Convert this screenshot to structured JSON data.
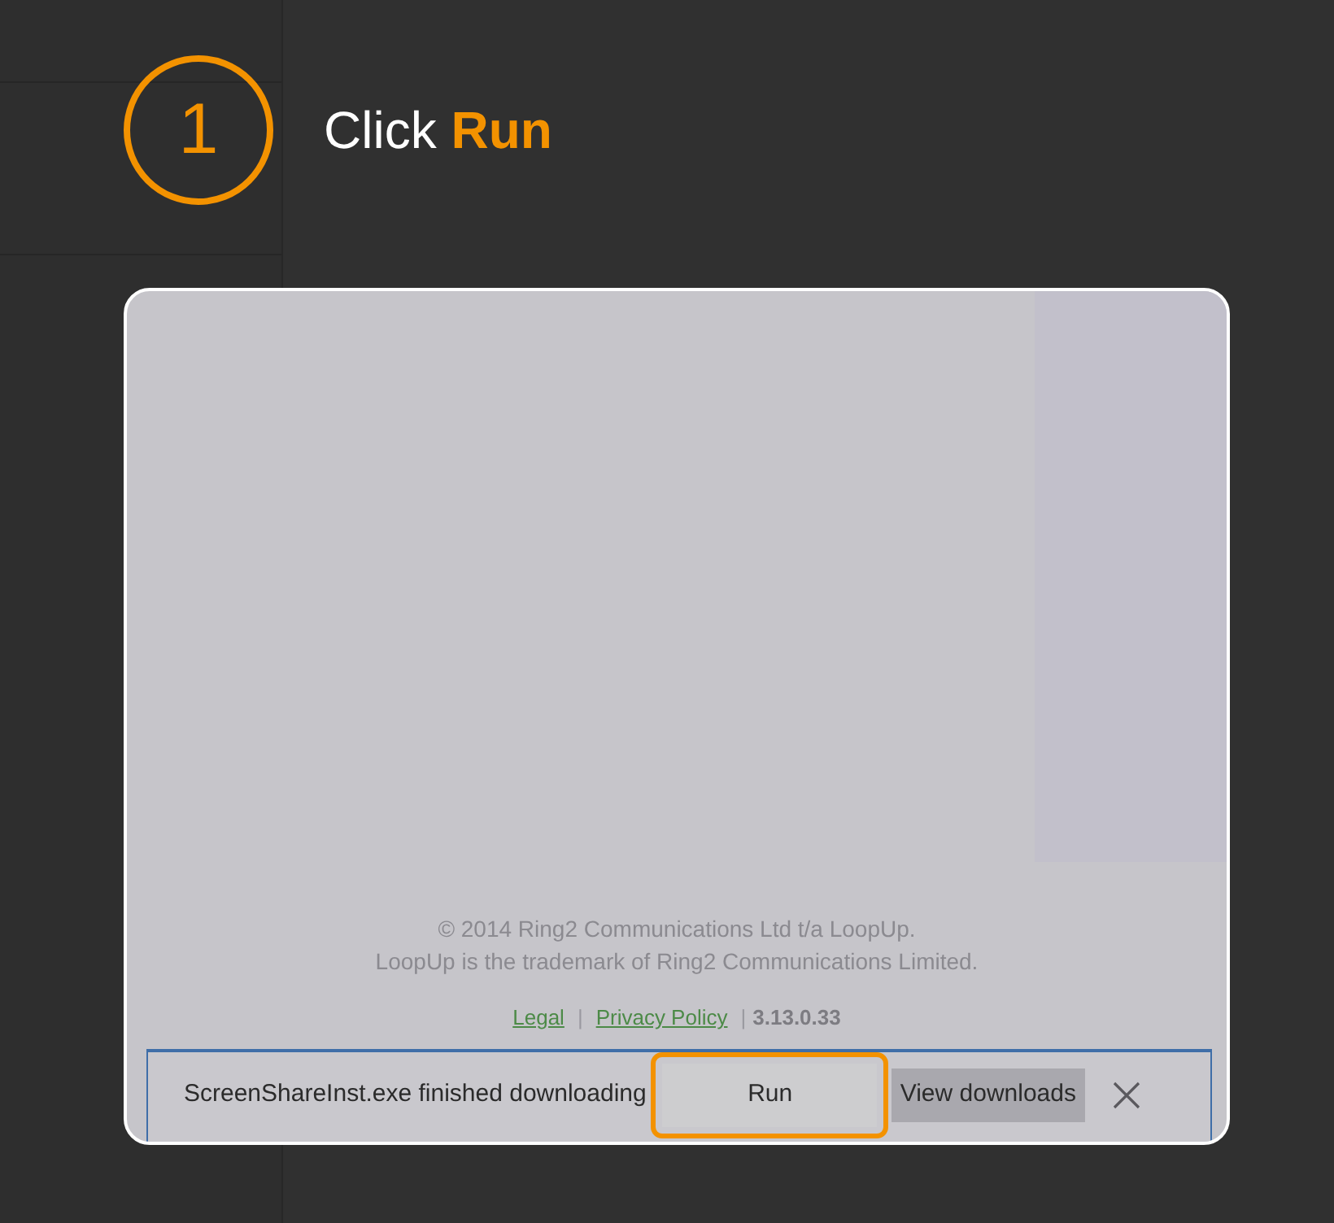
{
  "step": {
    "number": "1",
    "heading": "Click **Run**"
  },
  "screenshot": {
    "footer": {
      "copyright": "© 2014 Ring2 Communications Ltd t/a LoopUp.",
      "trademark": "LoopUp is the trademark of Ring2 Communications Limited.",
      "links": [
        {
          "label": "Legal"
        },
        {
          "label": "Privacy Policy"
        }
      ],
      "separator": "|",
      "version": "3.13.0.33"
    },
    "download_bar": {
      "message": "ScreenShareInst.exe finished downloading",
      "buttons": [
        {
          "label": "Run",
          "highlighted": true
        },
        {
          "label": "View downloads",
          "highlighted": false
        }
      ]
    }
  }
}
